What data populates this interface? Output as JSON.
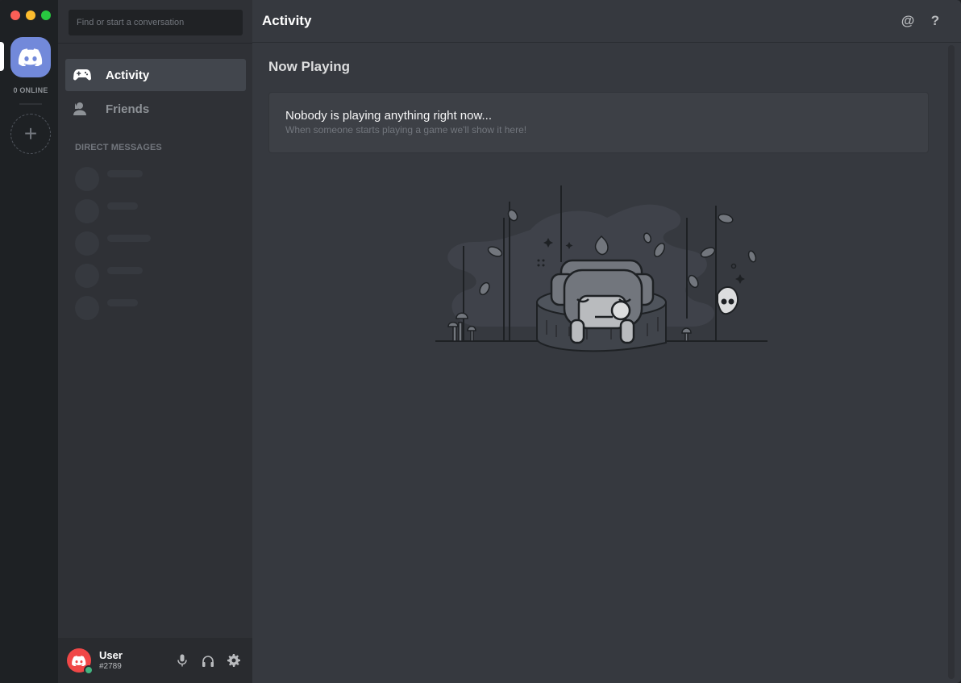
{
  "window": {
    "traffic_lights": [
      "close",
      "minimize",
      "maximize"
    ]
  },
  "rail": {
    "home_icon": "discord-logo-icon",
    "online_count": "0 ONLINE",
    "add_server_icon": "plus-icon"
  },
  "channels": {
    "search_placeholder": "Find or start a conversation",
    "nav": [
      {
        "label": "Activity",
        "icon": "gamepad-icon",
        "active": true
      },
      {
        "label": "Friends",
        "icon": "friends-icon",
        "active": false
      }
    ],
    "dm_header": "DIRECT MESSAGES"
  },
  "user": {
    "name": "User",
    "tag": "#2789",
    "status": "online",
    "controls": [
      "microphone-icon",
      "headphones-icon",
      "settings-gear-icon"
    ]
  },
  "main": {
    "title": "Activity",
    "actions": [
      "mentions-icon",
      "help-icon"
    ],
    "section_title": "Now Playing",
    "empty_title": "Nobody is playing anything right now...",
    "empty_subtitle": "When someone starts playing a game we'll show it here!"
  },
  "colors": {
    "blurple": "#7289da",
    "online": "#43b581",
    "avatar_red": "#f04747",
    "background": "#36393f"
  }
}
